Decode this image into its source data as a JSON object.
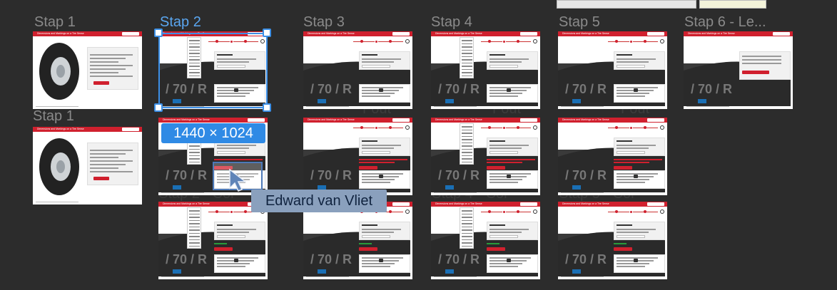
{
  "columns": [
    {
      "title": "Stap 1"
    },
    {
      "title": "Stap 2"
    },
    {
      "title": "Stap 3"
    },
    {
      "title": "Stap 4"
    },
    {
      "title": "Stap 5"
    },
    {
      "title": "Stap 6 - Le..."
    }
  ],
  "extra_title": "Stap 1",
  "frame_title": "Dimensions and Markings on a Tire Sense",
  "selection": {
    "size_label": "1440 × 1024"
  },
  "cursor_user": {
    "name": "Edward van Vliet"
  },
  "colors": {
    "canvas": "#2c2c2c",
    "brand_red": "#d0202e",
    "selection_blue": "#3c8fe6",
    "title_gray": "#8a8a8a",
    "user_tag": "#8aa0bd"
  }
}
